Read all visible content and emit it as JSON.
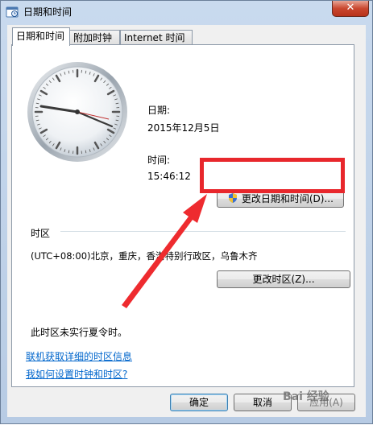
{
  "window": {
    "title": "日期和时间",
    "close_label": "✕"
  },
  "tabs": [
    {
      "label": "日期和时间",
      "active": true
    },
    {
      "label": "附加时钟",
      "active": false
    },
    {
      "label": "Internet 时间",
      "active": false
    }
  ],
  "datetime": {
    "date_label": "日期:",
    "date_value": "2015年12月5日",
    "time_label": "时间:",
    "time_value": "15:46:12",
    "change_button": "更改日期和时间(D)..."
  },
  "timezone": {
    "section_label": "时区",
    "value": "(UTC+08:00)北京，重庆，香港特别行政区，乌鲁木齐",
    "change_button": "更改时区(Z)...",
    "dst_note": "此时区未实行夏令时。"
  },
  "links": {
    "online_info": "联机获取详细的时区信息",
    "how_to": "我如何设置时钟和时区?"
  },
  "footer": {
    "ok": "确定",
    "cancel": "取消",
    "apply": "应用(A)"
  },
  "watermark": "Bai 经验",
  "colors": {
    "highlight": "#e8272c",
    "link": "#0066cc"
  }
}
